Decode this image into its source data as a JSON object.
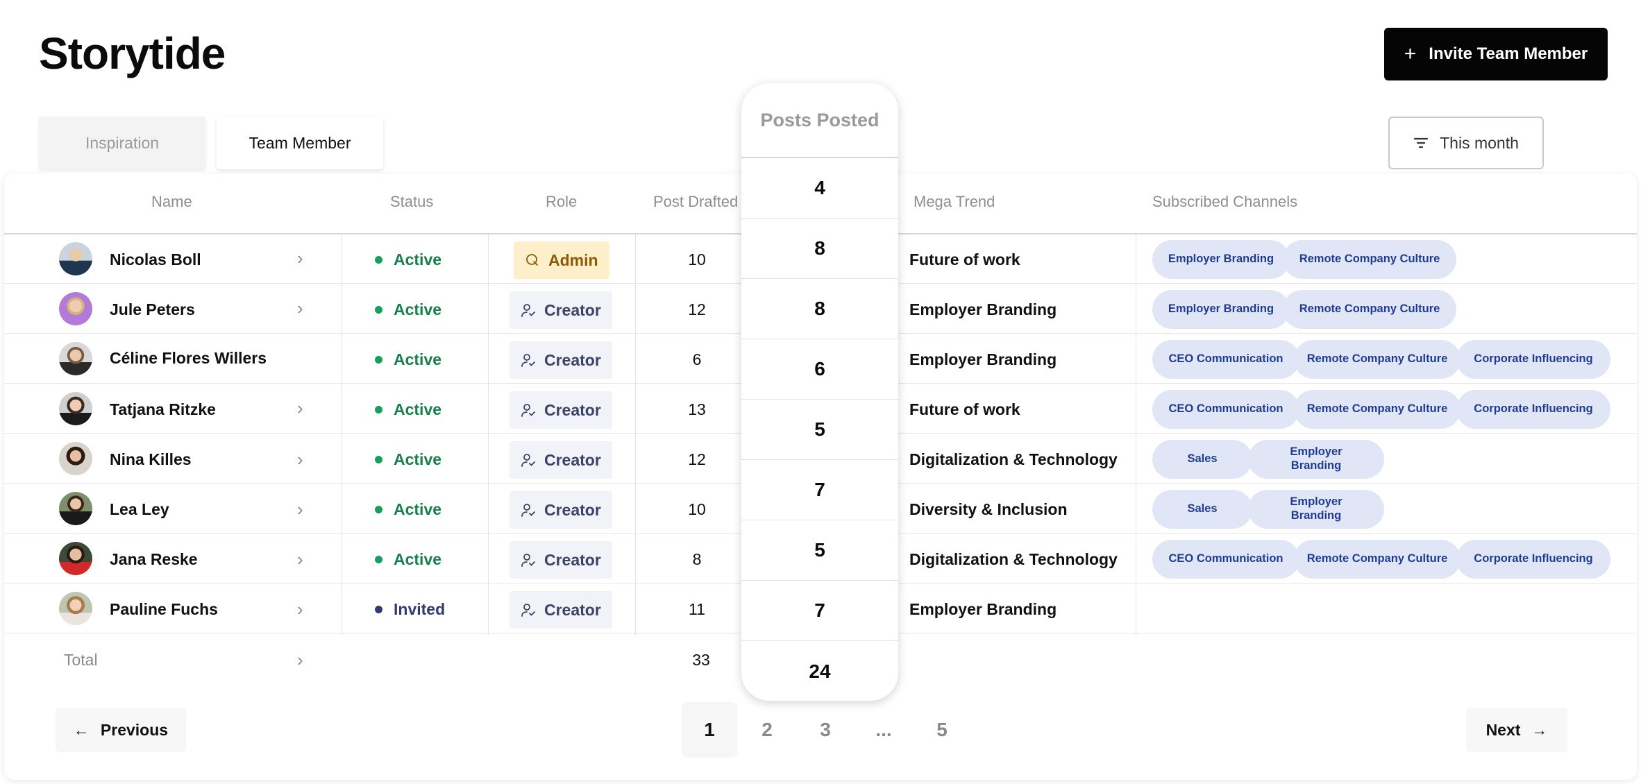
{
  "app": {
    "title": "Storytide"
  },
  "actions": {
    "invite_label": "Invite Team Member",
    "invite_icon": "plus-icon"
  },
  "tabs": [
    {
      "label": "Inspiration",
      "active": false
    },
    {
      "label": "Team Member",
      "active": true
    }
  ],
  "filter": {
    "label": "This month",
    "icon": "filter-icon"
  },
  "table": {
    "headers": {
      "name": "Name",
      "status": "Status",
      "role": "Role",
      "post_drafted": "Post Drafted",
      "mega_trend": "Mega Trend",
      "channels": "Subscribed Channels"
    },
    "rows": [
      {
        "name": "Nicolas Boll",
        "status": "Active",
        "role": "Admin",
        "drafted": "10",
        "posted": "4",
        "trend": "Future of work",
        "channels": [
          "Employer Branding",
          "Remote Company Culture"
        ]
      },
      {
        "name": "Jule Peters",
        "status": "Active",
        "role": "Creator",
        "drafted": "12",
        "posted": "8",
        "trend": "Employer Branding",
        "channels": [
          "Employer Branding",
          "Remote Company Culture"
        ]
      },
      {
        "name": "Céline Flores Willers",
        "status": "Active",
        "role": "Creator",
        "drafted": "6",
        "posted": "8",
        "trend": "Employer Branding",
        "channels": [
          "CEO Communication",
          "Remote Company Culture",
          "Corporate Influencing"
        ]
      },
      {
        "name": "Tatjana Ritzke",
        "status": "Active",
        "role": "Creator",
        "drafted": "13",
        "posted": "6",
        "trend": "Future of work",
        "channels": [
          "CEO Communication",
          "Remote Company Culture",
          "Corporate Influencing"
        ]
      },
      {
        "name": "Nina Killes",
        "status": "Active",
        "role": "Creator",
        "drafted": "12",
        "posted": "5",
        "trend": "Digitalization & Technology",
        "channels": [
          "Sales",
          "Employer Branding"
        ]
      },
      {
        "name": "Lea Ley",
        "status": "Active",
        "role": "Creator",
        "drafted": "10",
        "posted": "7",
        "trend": "Diversity & Inclusion",
        "channels": [
          "Sales",
          "Employer Branding"
        ]
      },
      {
        "name": "Jana Reske",
        "status": "Active",
        "role": "Creator",
        "drafted": "8",
        "posted": "5",
        "trend": "Digitalization & Technology",
        "channels": [
          "CEO Communication",
          "Remote Company Culture",
          "Corporate Influencing"
        ]
      },
      {
        "name": "Pauline Fuchs",
        "status": "Invited",
        "role": "Creator",
        "drafted": "11",
        "posted": "7",
        "trend": "Employer Branding",
        "channels": []
      }
    ],
    "total": {
      "label": "Total",
      "drafted": "33",
      "posted": "24"
    }
  },
  "posts_posted_popup": {
    "title": "Posts Posted"
  },
  "pagination": {
    "previous": "Previous",
    "next": "Next",
    "pages": [
      "1",
      "2",
      "3",
      "...",
      "5"
    ],
    "current": "1"
  },
  "colors": {
    "primary_button": "#050505",
    "active_status": "#17804d",
    "invited_status": "#323a6e",
    "admin_badge_bg": "#fdefc9",
    "chip_bg": "#e1e6f6",
    "chip_text": "#1f3d8f"
  }
}
